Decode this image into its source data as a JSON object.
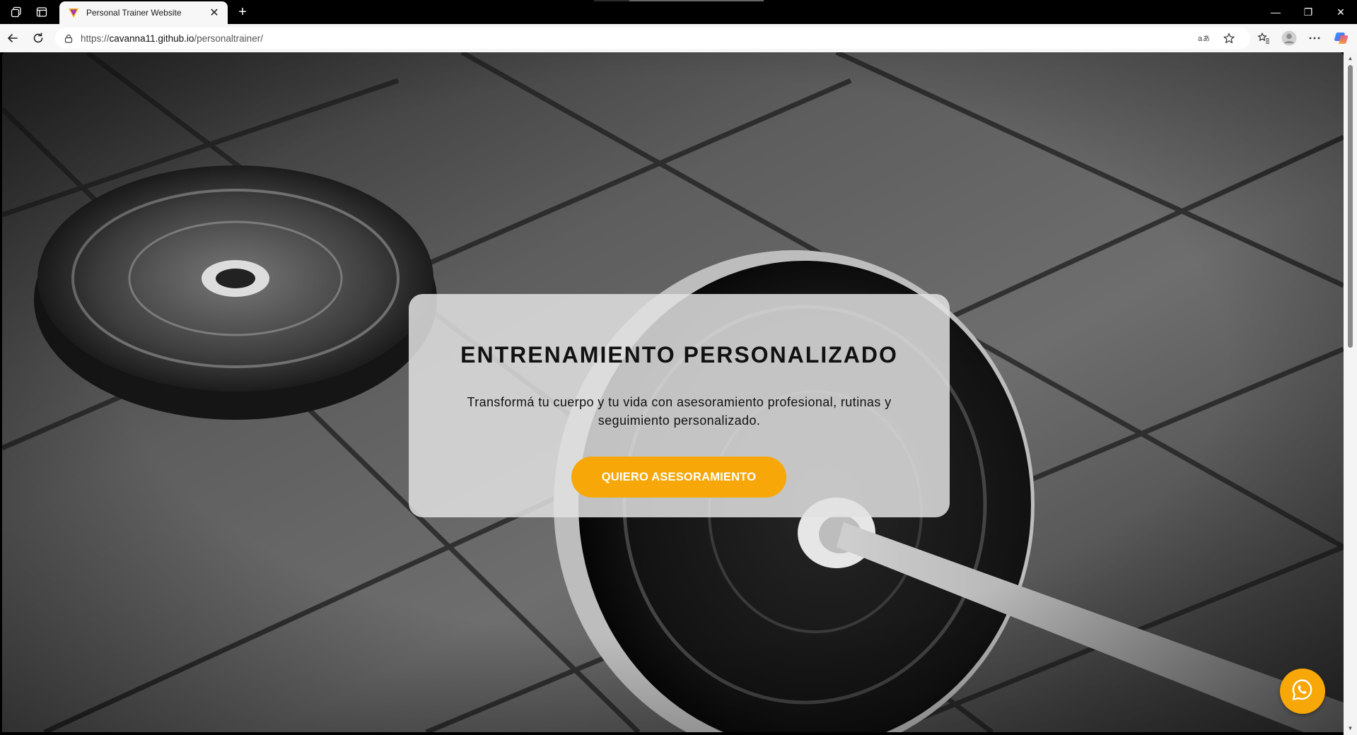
{
  "browser": {
    "tab": {
      "title": "Personal Trainer Website",
      "favicon": "triangle-logo-icon",
      "close_label": "✕"
    },
    "new_tab_label": "+",
    "window_controls": {
      "minimize": "—",
      "restore": "❐",
      "close": "✕"
    },
    "address": {
      "scheme": "https://",
      "host": "cavanna11.github.io",
      "path": "/personaltrainer/"
    },
    "icons": [
      "workspaces-icon",
      "tab-actions-icon",
      "back-icon",
      "refresh-icon",
      "lock-icon",
      "read-aloud-icon",
      "favorite-star-icon",
      "favorites-icon",
      "profile-icon",
      "more-icon",
      "copilot-icon"
    ]
  },
  "hero": {
    "title": "ENTRENAMIENTO PERSONALIZADO",
    "subtitle": "Transformá tu cuerpo y tu vida con asesoramiento profesional, rutinas y seguimiento personalizado.",
    "cta_label": "QUIERO ASESORAMIENTO",
    "background": "black-and-white barbell with weight plates on gym floor"
  },
  "floating": {
    "whatsapp_icon": "whatsapp-icon"
  },
  "colors": {
    "accent": "#f7a707",
    "card": "rgba(225,225,225,0.86)",
    "browser_frame": "#000000"
  }
}
